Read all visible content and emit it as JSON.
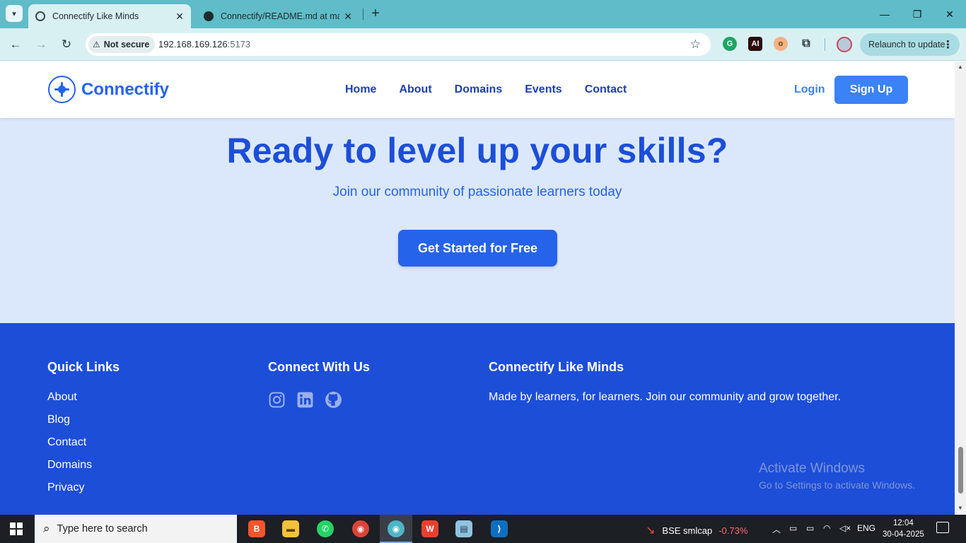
{
  "browser": {
    "tabs": [
      {
        "title": "Connectify Like Minds"
      },
      {
        "title": "Connectify/README.md at main"
      }
    ],
    "not_secure_label": "Not secure",
    "url_host": "192.168.169.126",
    "url_port": ":5173",
    "relaunch_label": "Relaunch to update"
  },
  "site": {
    "brand": "Connectify",
    "nav": [
      "Home",
      "About",
      "Domains",
      "Events",
      "Contact"
    ],
    "login_label": "Login",
    "signup_label": "Sign Up"
  },
  "cta": {
    "title": "Ready to level up your skills?",
    "subtitle": "Join our community of passionate learners today",
    "button_label": "Get Started for Free"
  },
  "footer": {
    "quick_links_heading": "Quick Links",
    "quick_links": [
      "About",
      "Blog",
      "Contact",
      "Domains",
      "Privacy"
    ],
    "connect_heading": "Connect With Us",
    "social_icons": [
      "instagram-icon",
      "linkedin-icon",
      "github-icon"
    ],
    "about_heading": "Connectify Like Minds",
    "about_text": "Made by learners, for learners. Join our community and grow together."
  },
  "watermark": {
    "line1": "Activate Windows",
    "line2": "Go to Settings to activate Windows."
  },
  "taskbar": {
    "search_placeholder": "Type here to search",
    "stock_name": "BSE smlcap",
    "stock_change": "-0.73%",
    "lang": "ENG",
    "time": "12:04",
    "date": "30-04-2025"
  },
  "colors": {
    "primary": "#2563eb",
    "primary_dark": "#1d4ed8",
    "cta_bg": "#dbe8fc",
    "chrome": "#5fbcc8"
  }
}
